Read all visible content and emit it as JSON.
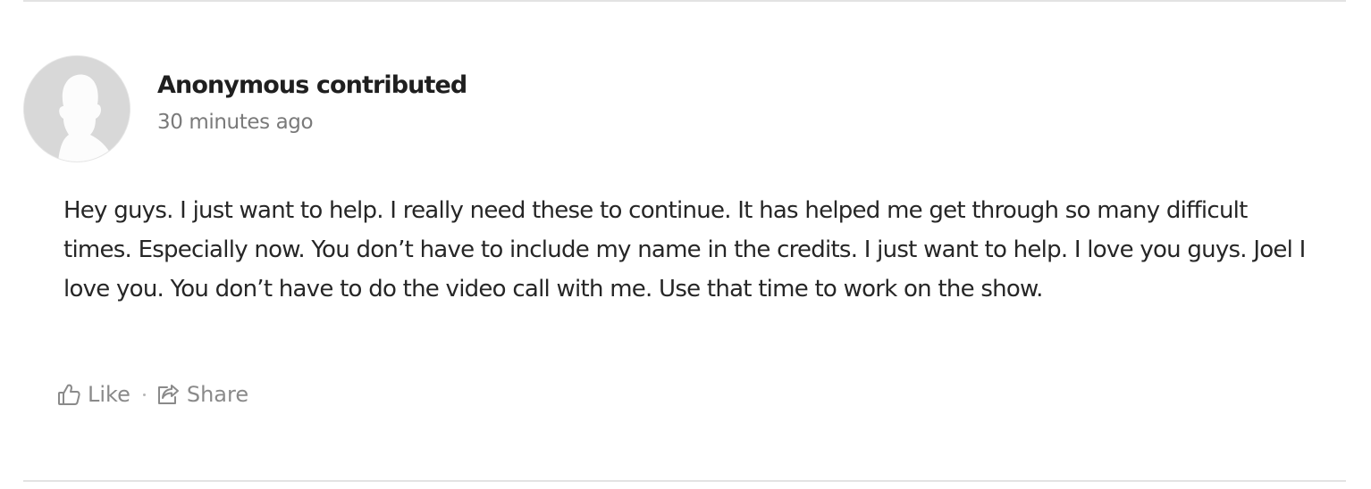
{
  "post": {
    "author": "Anonymous contributed",
    "timestamp": "30 minutes ago",
    "body": "Hey guys. I just want to help. I really need these to continue. It has helped me get through so many difficult times. Especially now. You don’t have to include my name in the credits. I just want to help. I love you guys. Joel I love you. You don’t have to do the video call with me. Use that time to work on the show."
  },
  "actions": {
    "like_label": "Like",
    "share_label": "Share",
    "like_icon": "thumbs-up-icon",
    "share_icon": "share-icon"
  },
  "colors": {
    "text": "#262626",
    "muted": "#8a8a8a",
    "avatar": "#d9d9d9",
    "divider": "#e3e3e3"
  }
}
